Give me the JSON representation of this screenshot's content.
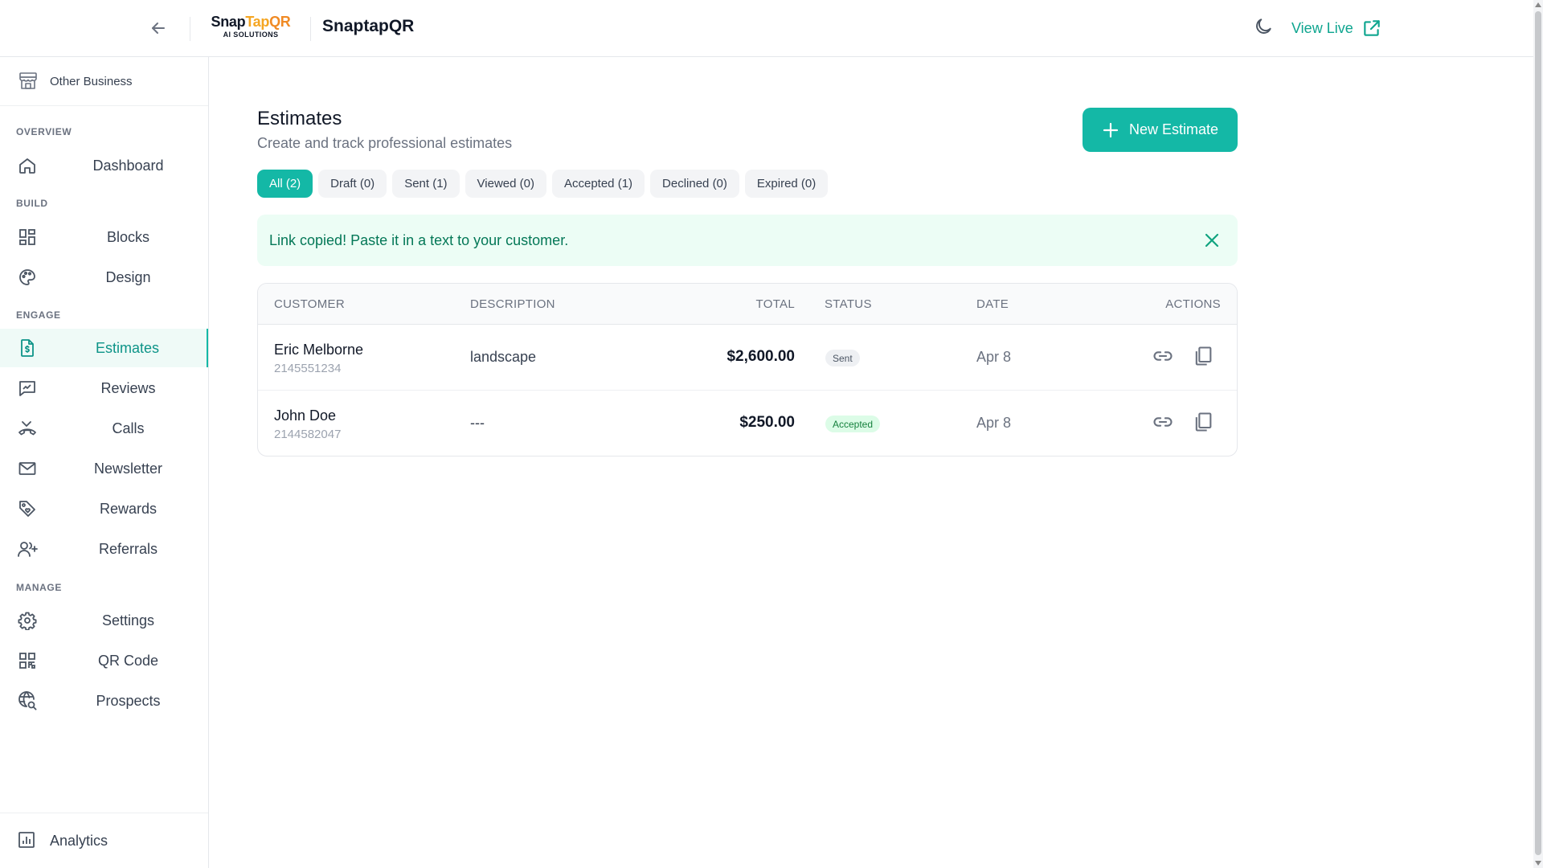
{
  "header": {
    "logo": {
      "snap": "Snap",
      "tap": "Tap",
      "qr": "QR",
      "sub": "AI SOLUTIONS"
    },
    "brand_title": "SnaptapQR",
    "view_live_label": "View Live"
  },
  "sidebar": {
    "business_label": "Other Business",
    "sections": {
      "overview": "OVERVIEW",
      "build": "BUILD",
      "engage": "ENGAGE",
      "manage": "MANAGE"
    },
    "items": {
      "dashboard": "Dashboard",
      "blocks": "Blocks",
      "design": "Design",
      "estimates": "Estimates",
      "reviews": "Reviews",
      "calls": "Calls",
      "newsletter": "Newsletter",
      "rewards": "Rewards",
      "referrals": "Referrals",
      "settings": "Settings",
      "qrcode": "QR Code",
      "prospects": "Prospects"
    },
    "active_item": "Estimates",
    "analytics_label": "Analytics"
  },
  "main": {
    "title": "Estimates",
    "subtitle": "Create and track professional estimates",
    "new_button_label": "New Estimate",
    "filters": [
      "All (2)",
      "Draft (0)",
      "Sent (1)",
      "Viewed (0)",
      "Accepted (1)",
      "Declined (0)",
      "Expired (0)"
    ],
    "active_filter": "All (2)",
    "alert_text": "Link copied! Paste it in a text to your customer.",
    "table": {
      "columns": [
        "CUSTOMER",
        "DESCRIPTION",
        "TOTAL",
        "STATUS",
        "DATE",
        "ACTIONS"
      ],
      "rows": [
        {
          "name": "Eric Melborne",
          "phone": "2145551234",
          "description": "landscape",
          "total": "$2,600.00",
          "status": "Sent",
          "date": "Apr 8"
        },
        {
          "name": "John Doe",
          "phone": "2144582047",
          "description": "---",
          "total": "$250.00",
          "status": "Accepted",
          "date": "Apr 8"
        }
      ]
    }
  },
  "colors": {
    "accent": "#14b8a6",
    "accent_text": "#0d9488",
    "alert_bg": "#ecfdf5",
    "alert_text": "#047857"
  },
  "icons": {
    "back": "arrow-left-icon",
    "theme": "moon-icon",
    "view_live": "external-link-icon",
    "business": "storefront-icon",
    "close": "close-icon",
    "row_link": "link-icon",
    "row_copy": "copy-icon"
  }
}
